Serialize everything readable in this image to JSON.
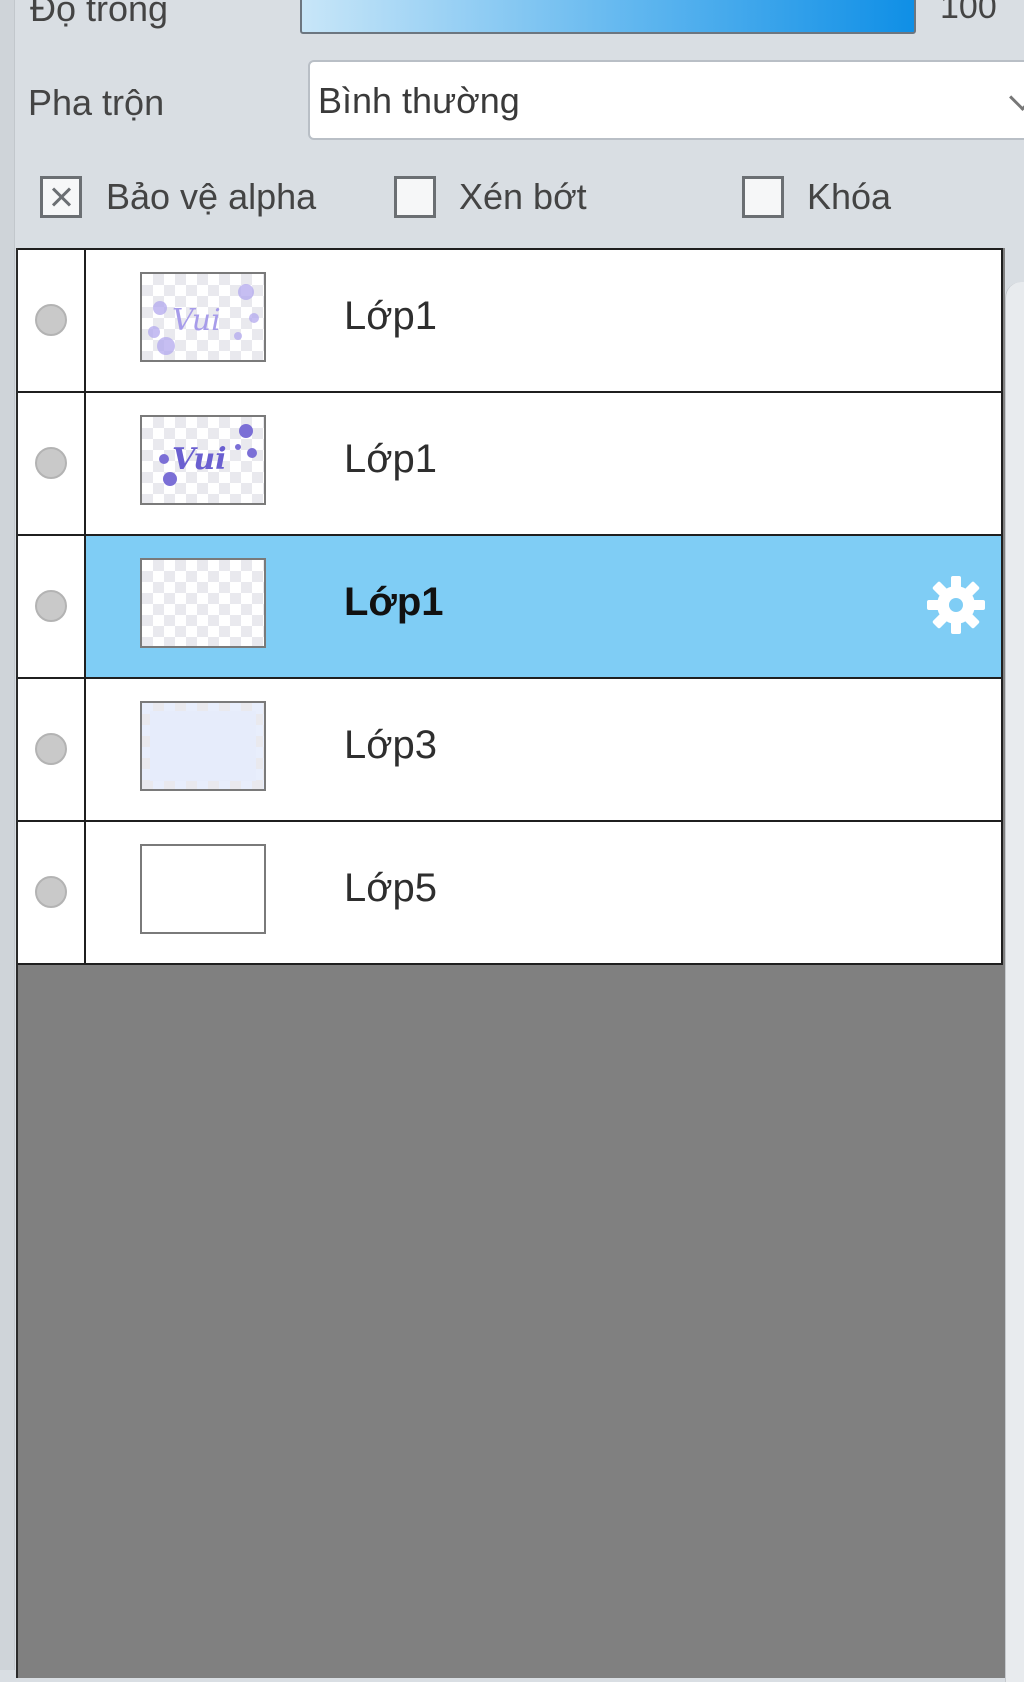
{
  "panel": {
    "opacity_label": "Độ trong",
    "opacity_value": "100",
    "blend_label": "Pha trộn",
    "blend_value": "Bình thường",
    "checkboxes": [
      {
        "label": "Bảo vệ alpha",
        "checked": true
      },
      {
        "label": "Xén bớt",
        "checked": false
      },
      {
        "label": "Khóa",
        "checked": false
      }
    ]
  },
  "layers": [
    {
      "name": "Lớp1",
      "thumbnail": "vui-faint",
      "selected": false
    },
    {
      "name": "Lớp1",
      "thumbnail": "vui-dots",
      "selected": false
    },
    {
      "name": "Lớp1",
      "thumbnail": "transparent",
      "selected": true,
      "icon": "gear-icon"
    },
    {
      "name": "Lớp3",
      "thumbnail": "light-blue",
      "selected": false
    },
    {
      "name": "Lớp5",
      "thumbnail": "white",
      "selected": false
    }
  ],
  "colors": {
    "selection": "#7fcdf5",
    "opacity_gradient_end": "#0f8fe6",
    "list_background": "#808080",
    "thumbnail_ink": "#7b6fd6"
  }
}
